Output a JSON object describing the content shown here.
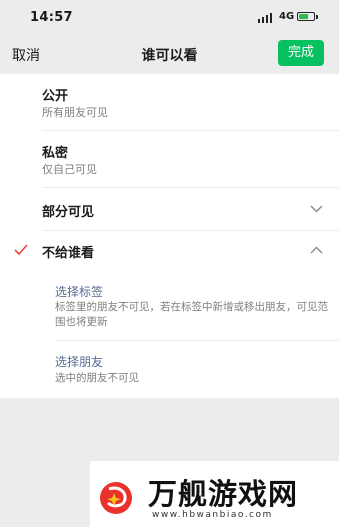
{
  "status_bar": {
    "time": "14:57",
    "network": "4G"
  },
  "nav": {
    "cancel_label": "取消",
    "title": "谁可以看",
    "done_label": "完成"
  },
  "options": [
    {
      "title": "公开",
      "description": "所有朋友可见"
    },
    {
      "title": "私密",
      "description": "仅自己可见"
    },
    {
      "title": "部分可见"
    },
    {
      "title": "不给谁看"
    }
  ],
  "selected_option": "不给谁看",
  "sub_options": [
    {
      "title": "选择标签",
      "description": "标签里的朋友不可见，若在标签中新增或移出朋友，可见范围也将更新"
    },
    {
      "title": "选择朋友",
      "description": "选中的朋友不可见"
    }
  ],
  "watermark": {
    "title": "万舰游戏网",
    "url": "www.hbwanbiao.com"
  },
  "colors": {
    "accent": "#07c160",
    "link": "#576b95",
    "check": "#e64340"
  }
}
